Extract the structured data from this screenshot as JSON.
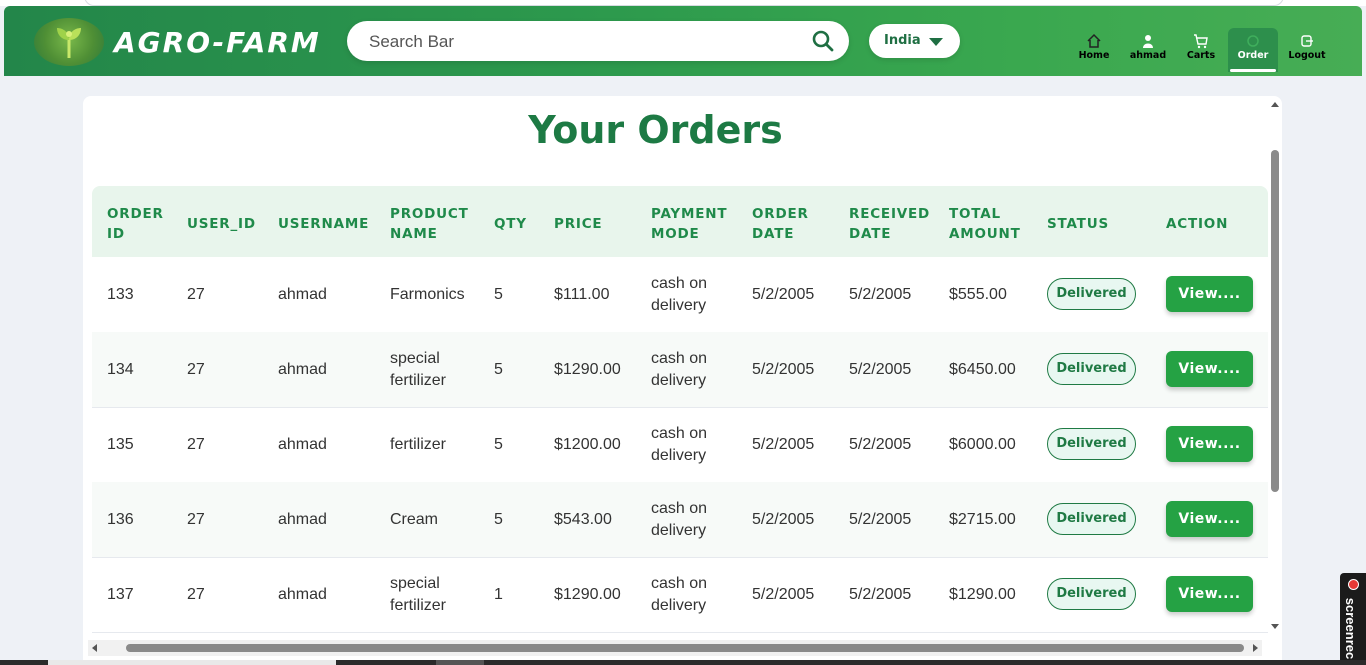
{
  "brand": "AGRO-FARM",
  "search": {
    "placeholder": "Search Bar"
  },
  "country": {
    "selected": "India"
  },
  "nav": [
    {
      "label": "Home",
      "icon": "home-icon"
    },
    {
      "label": "ahmad",
      "icon": "user-icon"
    },
    {
      "label": "Carts",
      "icon": "cart-icon"
    },
    {
      "label": "Order",
      "icon": "order-icon",
      "active": true
    },
    {
      "label": "Logout",
      "icon": "logout-icon"
    }
  ],
  "page": {
    "title": "Your Orders"
  },
  "table": {
    "headers": [
      [
        "ORDER",
        "ID"
      ],
      [
        "USER_ID"
      ],
      [
        "USERNAME"
      ],
      [
        "PRODUCT",
        "NAME"
      ],
      [
        "QTY"
      ],
      [
        "PRICE"
      ],
      [
        "PAYMENT",
        "MODE"
      ],
      [
        "ORDER",
        "DATE"
      ],
      [
        "RECEIVED",
        "DATE"
      ],
      [
        "TOTAL",
        "AMOUNT"
      ],
      [
        "STATUS"
      ],
      [
        "ACTION"
      ]
    ],
    "rows": [
      {
        "order_id": "133",
        "user_id": "27",
        "username": "ahmad",
        "product": [
          "Farmonics"
        ],
        "qty": "5",
        "price": "$111.00",
        "payment": [
          "cash on",
          "delivery"
        ],
        "order_date": "5/2/2005",
        "received_date": "5/2/2005",
        "total": "$555.00",
        "status": "Delivered",
        "action": "View...."
      },
      {
        "order_id": "134",
        "user_id": "27",
        "username": "ahmad",
        "product": [
          "special",
          "fertilizer"
        ],
        "qty": "5",
        "price": "$1290.00",
        "payment": [
          "cash on",
          "delivery"
        ],
        "order_date": "5/2/2005",
        "received_date": "5/2/2005",
        "total": "$6450.00",
        "status": "Delivered",
        "action": "View...."
      },
      {
        "order_id": "135",
        "user_id": "27",
        "username": "ahmad",
        "product": [
          "fertilizer"
        ],
        "qty": "5",
        "price": "$1200.00",
        "payment": [
          "cash on",
          "delivery"
        ],
        "order_date": "5/2/2005",
        "received_date": "5/2/2005",
        "total": "$6000.00",
        "status": "Delivered",
        "action": "View...."
      },
      {
        "order_id": "136",
        "user_id": "27",
        "username": "ahmad",
        "product": [
          "Cream"
        ],
        "qty": "5",
        "price": "$543.00",
        "payment": [
          "cash on",
          "delivery"
        ],
        "order_date": "5/2/2005",
        "received_date": "5/2/2005",
        "total": "$2715.00",
        "status": "Delivered",
        "action": "View...."
      },
      {
        "order_id": "137",
        "user_id": "27",
        "username": "ahmad",
        "product": [
          "special",
          "fertilizer"
        ],
        "qty": "1",
        "price": "$1290.00",
        "payment": [
          "cash on",
          "delivery"
        ],
        "order_date": "5/2/2005",
        "received_date": "5/2/2005",
        "total": "$1290.00",
        "status": "Delivered",
        "action": "View...."
      }
    ]
  },
  "recorder": {
    "label": "screenrec"
  },
  "colors": {
    "primary": "#23864a",
    "accent": "#25a244",
    "title": "#1d7a44",
    "header_bg": "#e8f5ec"
  }
}
